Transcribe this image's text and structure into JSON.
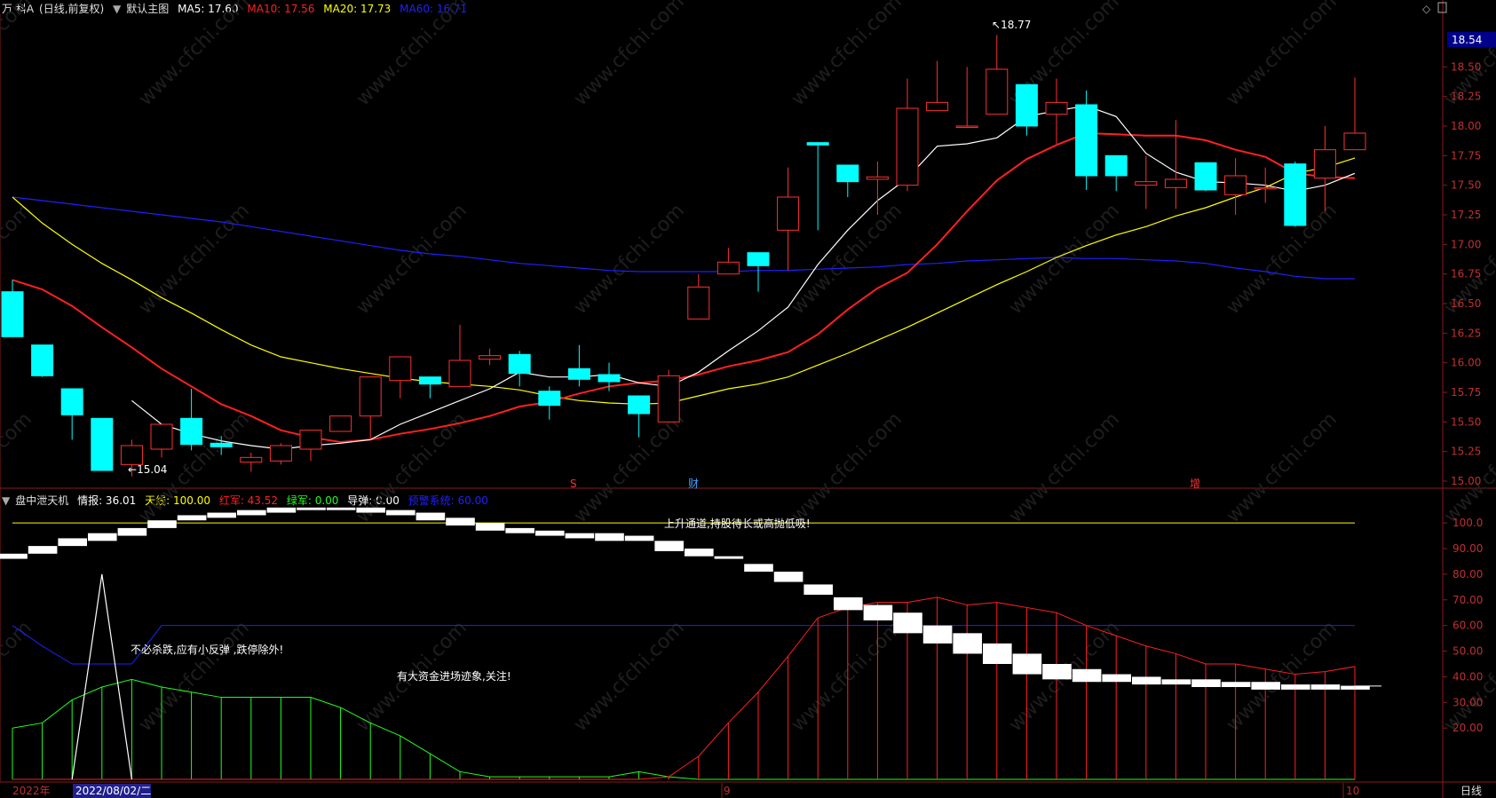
{
  "header": {
    "stock_name": "万 科A",
    "mode": "(日线,前复权)",
    "template": "默认主图",
    "ma5": {
      "label": "MA5: 17.60",
      "color": "#ffffff"
    },
    "ma10": {
      "label": "MA10: 17.56",
      "color": "#ff2020"
    },
    "ma20": {
      "label": "MA20: 17.73",
      "color": "#ffff00"
    },
    "ma60": {
      "label": "MA60: 16.71",
      "color": "#2020ff"
    }
  },
  "indicator_header": {
    "name": "盘中泄天机",
    "qingbao": "情报: 36.01",
    "tianxian": "天线: 100.00",
    "hongjun": "红军: 43.52",
    "lvjun": "绿军: 0.00",
    "daodan": "导弹: 0.00",
    "yujing": "预警系统: 60.00"
  },
  "price_badge": "18.54",
  "period_label": "日线",
  "markers": {
    "s": "S",
    "cai": "财",
    "zeng": "增"
  },
  "high_label": "18.77",
  "low_label": "15.04",
  "annotations": {
    "up_channel": "上升通道,持股待长或高抛低吸!",
    "no_kill": "不必杀跌,应有小反弹 ,跌停除外!",
    "big_money": "有大资金进场迹象,关注!"
  },
  "date_axis": {
    "year": "2022年",
    "selected": "2022/08/02/二",
    "sep": "9",
    "end": "10"
  },
  "watermark": "www.cfchi.com",
  "chart_data": {
    "type": "candlestick",
    "price_axis": {
      "ticks": [
        "18.50",
        "18.25",
        "18.00",
        "17.75",
        "17.50",
        "17.25",
        "17.00",
        "16.75",
        "16.50",
        "16.25",
        "16.00",
        "15.75",
        "15.50",
        "15.25",
        "15.00"
      ],
      "ylim": [
        14.94,
        18.84
      ]
    },
    "candles": [
      [
        16.6,
        16.22,
        16.7,
        16.22
      ],
      [
        16.15,
        15.89,
        16.15,
        15.88
      ],
      [
        15.78,
        15.56,
        15.78,
        15.35
      ],
      [
        15.53,
        15.09,
        15.53,
        15.09
      ],
      [
        15.14,
        15.3,
        15.35,
        15.04
      ],
      [
        15.27,
        15.48,
        15.48,
        15.2
      ],
      [
        15.53,
        15.31,
        15.78,
        15.26
      ],
      [
        15.32,
        15.29,
        15.38,
        15.22
      ],
      [
        15.16,
        15.2,
        15.24,
        15.08
      ],
      [
        15.17,
        15.3,
        15.32,
        15.14
      ],
      [
        15.27,
        15.43,
        15.43,
        15.17
      ],
      [
        15.42,
        15.55,
        15.55,
        15.42
      ],
      [
        15.55,
        15.88,
        15.8,
        15.35
      ],
      [
        15.85,
        16.05,
        16.05,
        15.7
      ],
      [
        15.88,
        15.82,
        15.88,
        15.7
      ],
      [
        15.8,
        16.02,
        16.32,
        15.8
      ],
      [
        16.03,
        16.06,
        16.12,
        15.98
      ],
      [
        16.07,
        15.91,
        16.1,
        15.8
      ],
      [
        15.76,
        15.64,
        15.8,
        15.52
      ],
      [
        15.95,
        15.86,
        16.15,
        15.8
      ],
      [
        15.9,
        15.84,
        16.0,
        15.76
      ],
      [
        15.72,
        15.57,
        15.72,
        15.37
      ],
      [
        15.5,
        15.89,
        15.94,
        15.5
      ],
      [
        16.37,
        16.64,
        16.75,
        16.37
      ],
      [
        16.75,
        16.85,
        16.97,
        16.75
      ],
      [
        16.93,
        16.82,
        16.93,
        16.6
      ],
      [
        17.12,
        17.4,
        17.65,
        16.78
      ],
      [
        17.86,
        17.84,
        17.86,
        17.12
      ],
      [
        17.67,
        17.53,
        17.67,
        17.4
      ],
      [
        17.55,
        17.57,
        17.7,
        17.25
      ],
      [
        17.5,
        18.15,
        18.4,
        17.45
      ],
      [
        18.13,
        18.2,
        18.55,
        18.13
      ],
      [
        18.0,
        18.0,
        18.5,
        18.0
      ],
      [
        18.1,
        18.48,
        18.77,
        18.1
      ],
      [
        18.35,
        18.0,
        18.35,
        17.92
      ],
      [
        18.1,
        18.2,
        18.4,
        17.85
      ],
      [
        18.18,
        17.58,
        18.3,
        17.46
      ],
      [
        17.75,
        17.58,
        17.75,
        17.45
      ],
      [
        17.5,
        17.53,
        17.75,
        17.3
      ],
      [
        17.48,
        17.55,
        18.05,
        17.3
      ],
      [
        17.69,
        17.46,
        17.69,
        17.45
      ],
      [
        17.42,
        17.58,
        17.73,
        17.25
      ],
      [
        17.47,
        17.48,
        17.65,
        17.35
      ],
      [
        17.68,
        17.16,
        17.7,
        17.15
      ],
      [
        17.56,
        17.8,
        18.0,
        17.28
      ],
      [
        17.8,
        17.94,
        18.41,
        17.8
      ]
    ],
    "series": [
      {
        "name": "MA5",
        "color": "#ffffff",
        "values": [
          null,
          null,
          null,
          null,
          15.68,
          15.48,
          15.4,
          15.34,
          15.3,
          15.27,
          15.3,
          15.32,
          15.35,
          15.48,
          15.58,
          15.68,
          15.78,
          15.92,
          15.88,
          15.88,
          15.9,
          15.83,
          15.8,
          15.92,
          16.1,
          16.27,
          16.47,
          16.83,
          17.12,
          17.37,
          17.56,
          17.83,
          17.85,
          17.9,
          18.08,
          18.13,
          18.17,
          18.08,
          17.77,
          17.61,
          17.53,
          17.52,
          17.5,
          17.45,
          17.5,
          17.6
        ]
      },
      {
        "name": "MA10",
        "color": "#ff2020",
        "values": [
          16.7,
          16.62,
          16.48,
          16.3,
          16.13,
          15.95,
          15.8,
          15.65,
          15.55,
          15.43,
          15.37,
          15.33,
          15.35,
          15.4,
          15.44,
          15.49,
          15.55,
          15.63,
          15.67,
          15.74,
          15.8,
          15.83,
          15.85,
          15.9,
          15.97,
          16.02,
          16.09,
          16.24,
          16.45,
          16.63,
          16.76,
          17.0,
          17.28,
          17.54,
          17.72,
          17.84,
          17.94,
          17.93,
          17.92,
          17.92,
          17.88,
          17.8,
          17.74,
          17.6,
          17.57,
          17.56
        ]
      },
      {
        "name": "MA20",
        "color": "#ffff00",
        "values": [
          17.4,
          17.18,
          17.0,
          16.84,
          16.7,
          16.55,
          16.42,
          16.28,
          16.15,
          16.05,
          16.0,
          15.95,
          15.91,
          15.87,
          15.84,
          15.82,
          15.8,
          15.77,
          15.72,
          15.68,
          15.66,
          15.65,
          15.66,
          15.72,
          15.78,
          15.82,
          15.88,
          15.98,
          16.08,
          16.19,
          16.3,
          16.42,
          16.54,
          16.66,
          16.77,
          16.89,
          16.99,
          17.08,
          17.15,
          17.24,
          17.31,
          17.4,
          17.48,
          17.6,
          17.65,
          17.73
        ]
      },
      {
        "name": "MA60",
        "color": "#2020ff",
        "values": [
          17.4,
          17.37,
          17.34,
          17.31,
          17.28,
          17.25,
          17.22,
          17.19,
          17.15,
          17.11,
          17.07,
          17.03,
          16.99,
          16.95,
          16.92,
          16.9,
          16.87,
          16.84,
          16.82,
          16.8,
          16.78,
          16.77,
          16.77,
          16.77,
          16.77,
          16.78,
          16.78,
          16.79,
          16.8,
          16.81,
          16.83,
          16.84,
          16.86,
          16.87,
          16.88,
          16.89,
          16.88,
          16.88,
          16.87,
          16.86,
          16.84,
          16.8,
          16.77,
          16.73,
          16.71,
          16.71
        ]
      }
    ],
    "indicator": {
      "axis_ticks": [
        "100.0",
        "90.00",
        "80.00",
        "70.00",
        "60.00",
        "50.00",
        "40.00",
        "30.00",
        "20.00"
      ],
      "ylim": [
        0,
        108
      ],
      "tianxian": 100,
      "yujing": 60,
      "qingbao_bars": [
        [
          86,
          88
        ],
        [
          88,
          91
        ],
        [
          91,
          94
        ],
        [
          93,
          96
        ],
        [
          95,
          98
        ],
        [
          98,
          101
        ],
        [
          101,
          103
        ],
        [
          102,
          104
        ],
        [
          103,
          105
        ],
        [
          104,
          106
        ],
        [
          105,
          106
        ],
        [
          105,
          106
        ],
        [
          104,
          106
        ],
        [
          103,
          105
        ],
        [
          101,
          104
        ],
        [
          99,
          102
        ],
        [
          97,
          100
        ],
        [
          96,
          98
        ],
        [
          95,
          97
        ],
        [
          94,
          96
        ],
        [
          93,
          96
        ],
        [
          93,
          95
        ],
        [
          89,
          93
        ],
        [
          87,
          90
        ],
        [
          86,
          87
        ],
        [
          81,
          84
        ],
        [
          77,
          81
        ],
        [
          72,
          76
        ],
        [
          66,
          71
        ],
        [
          62,
          68
        ],
        [
          57,
          65
        ],
        [
          53,
          60
        ],
        [
          49,
          57
        ],
        [
          45,
          53
        ],
        [
          41,
          49
        ],
        [
          39,
          45
        ],
        [
          38,
          43
        ],
        [
          38,
          41
        ],
        [
          37,
          40
        ],
        [
          37,
          39
        ],
        [
          36,
          39
        ],
        [
          36,
          38
        ],
        [
          35,
          38
        ],
        [
          35,
          37
        ],
        [
          35,
          37
        ],
        [
          35,
          36.5
        ]
      ],
      "red_line": [
        0,
        0,
        0,
        0,
        0,
        0,
        0,
        0,
        0,
        0,
        0,
        0,
        0,
        0,
        0,
        0,
        0,
        0,
        0,
        0,
        0,
        0,
        1,
        9,
        22,
        34,
        48,
        63,
        67,
        69,
        69,
        71,
        68,
        69,
        67,
        65,
        60,
        56,
        52,
        49,
        45,
        45,
        43,
        41,
        42,
        44
      ],
      "green_line": [
        20,
        22,
        31,
        36,
        39,
        36,
        34,
        32,
        32,
        32,
        32,
        28,
        22,
        17,
        10,
        3,
        1,
        1,
        1,
        1,
        1,
        3,
        1,
        0,
        0,
        0,
        0,
        0,
        0,
        0,
        0,
        0,
        0,
        0,
        0,
        0,
        0,
        0,
        0,
        0,
        0,
        0,
        0,
        0,
        0,
        0
      ],
      "blue_line": [
        60,
        52,
        45,
        45,
        45,
        60,
        60,
        60,
        60,
        60,
        60,
        60,
        60,
        60,
        60,
        60,
        60,
        60,
        60,
        60,
        60,
        60,
        60,
        60,
        60,
        60,
        60,
        60,
        60,
        60,
        60,
        60,
        60,
        60,
        60,
        60,
        60,
        60,
        60,
        60,
        60,
        60,
        60,
        60,
        60,
        60
      ],
      "white_spike": {
        "index": 3,
        "value": 80
      }
    }
  }
}
